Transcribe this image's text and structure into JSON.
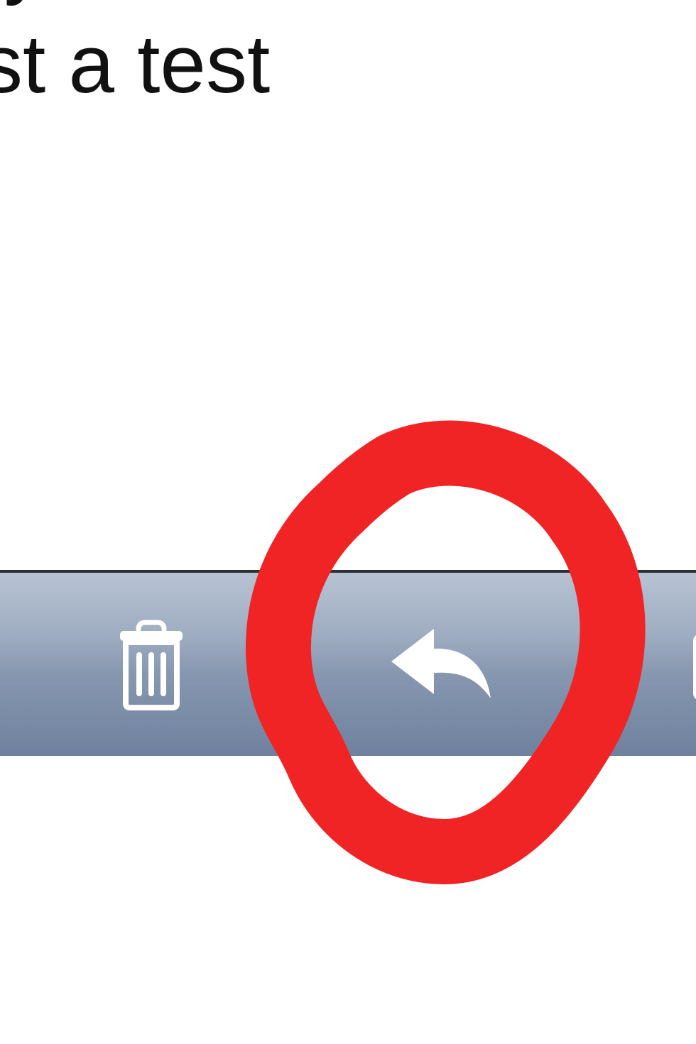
{
  "message": {
    "partial_line": "ly",
    "line": "st a test"
  },
  "toolbar": {
    "buttons": [
      {
        "name": "trash-button",
        "icon": "trash-icon"
      },
      {
        "name": "reply-button",
        "icon": "reply-icon"
      },
      {
        "name": "next-button",
        "icon": "folder-icon"
      }
    ]
  },
  "colors": {
    "toolbar_top": "#b7c3d3",
    "toolbar_bottom": "#6f819e",
    "icon": "#ffffff",
    "annotation": "#f02424"
  }
}
